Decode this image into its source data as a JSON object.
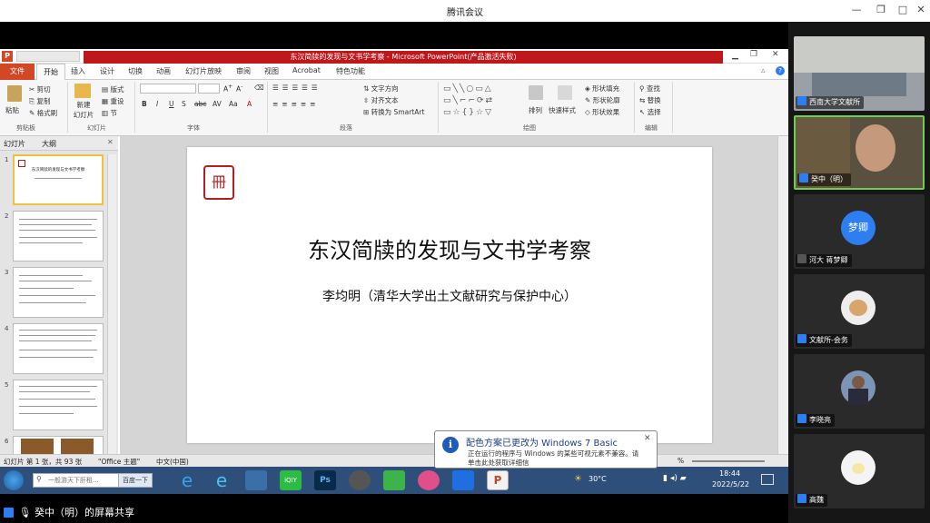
{
  "meeting": {
    "title": "腾讯会议",
    "controls": [
      "—",
      "❐",
      "□",
      "✕"
    ]
  },
  "ppt": {
    "window_title": "东汉简牍的发现与文书学考察 - Microsoft PowerPoint(产品激活失败)",
    "logo": "P",
    "menu": [
      "文件",
      "开始",
      "插入",
      "设计",
      "切换",
      "动画",
      "幻灯片放映",
      "审阅",
      "视图",
      "Acrobat",
      "特色功能"
    ],
    "ribbon": {
      "paste": "粘贴",
      "cut": "剪切",
      "copy": "复制",
      "format_painter": "格式刷",
      "new_slide": "新建\n幻灯片",
      "layout": "版式",
      "reset": "重设",
      "section": "节",
      "text_direction": "文字方向",
      "align_text": "对齐文本",
      "smartart": "转换为 SmartArt",
      "arrange": "排列",
      "quick_styles": "快速样式",
      "shape_fill": "形状填充",
      "shape_outline": "形状轮廓",
      "shape_effects": "形状效果",
      "find": "查找",
      "replace": "替换",
      "select": "选择",
      "groups": [
        "剪贴板",
        "幻灯片",
        "字体",
        "段落",
        "绘图",
        "编辑"
      ]
    },
    "panel_tabs": [
      "幻灯片",
      "大纲"
    ],
    "thumb_numbers": [
      "1",
      "2",
      "3",
      "4",
      "5",
      "6"
    ],
    "thumb1_title": "东汉简牍的发现与文书学考察",
    "slide": {
      "seal_char": "冊",
      "title": "东汉简牍的发现与文书学考察",
      "subtitle": "李均明（清华大学出土文献研究与保护中心）"
    },
    "status": {
      "slide_info": "幻灯片 第 1 张，共 93 张",
      "theme": "\"Office 主题\"",
      "language": "中文(中国)",
      "zoom": "%"
    }
  },
  "taskbar": {
    "search_placeholder": "一般游天下肝租...",
    "search_button": "百度一下",
    "weather": "30°C",
    "time": "18:44",
    "date": "2022/5/22"
  },
  "balloon": {
    "title": "配色方案已更改为 Windows 7 Basic",
    "line1": "正在运行的程序与 Windows 的某些可视元素不兼容。请",
    "line2": "单击此处获取详细信"
  },
  "share": {
    "text": "癸中（明）的屏幕共享"
  },
  "participants": [
    {
      "name": "西南大学文献所",
      "avatar_text": "",
      "type": "video",
      "color": "#8a8a8a"
    },
    {
      "name": "癸中（明）",
      "avatar_text": "",
      "type": "video",
      "color": "#6d5a3a"
    },
    {
      "name": "河大 蒋梦卿",
      "avatar_text": "梦卿",
      "type": "avatar",
      "color": "#2d7ef0"
    },
    {
      "name": "文献所-会务",
      "avatar_text": "",
      "type": "avatar",
      "color": "#e8e8e8"
    },
    {
      "name": "李晓亮",
      "avatar_text": "",
      "type": "avatar",
      "color": "#7c94b6"
    },
    {
      "name": "高魏",
      "avatar_text": "",
      "type": "avatar",
      "color": "#f4f4f4"
    }
  ]
}
